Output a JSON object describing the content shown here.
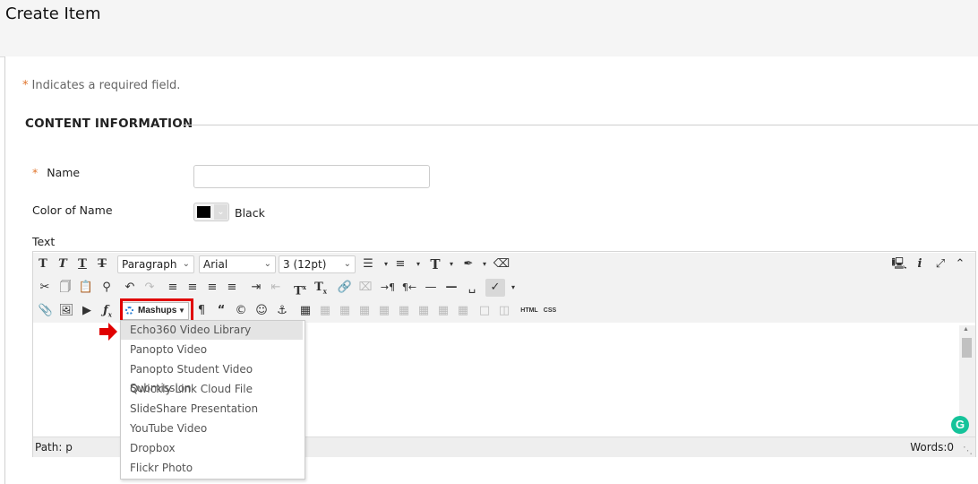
{
  "page": {
    "title": "Create Item"
  },
  "form": {
    "required_star": "*",
    "required_note": "Indicates a required field.",
    "section_title": "CONTENT INFORMATION",
    "name_label": "Name",
    "name_value": "",
    "color_label": "Color of Name",
    "color_value": "Black",
    "color_hex": "#000000",
    "text_label": "Text"
  },
  "editor": {
    "paragraph_select": "Paragraph",
    "font_select": "Arial",
    "size_select": "3 (12pt)",
    "mashups_label": "Mashups",
    "html_btn": "HTML",
    "css_btn": "CSS",
    "path_label": "Path: p",
    "words_label": "Words:0",
    "grammarly": "G"
  },
  "mashups_menu": {
    "items": [
      "Echo360 Video Library",
      "Panopto Video",
      "Panopto Student Video Submission",
      "Qwickly Link Cloud File",
      "SlideShare Presentation",
      "YouTube Video",
      "Dropbox",
      "Flickr Photo"
    ]
  },
  "colors": {
    "highlight": "#e00000",
    "accent": "#e0742b",
    "grammarly": "#15c39a"
  }
}
